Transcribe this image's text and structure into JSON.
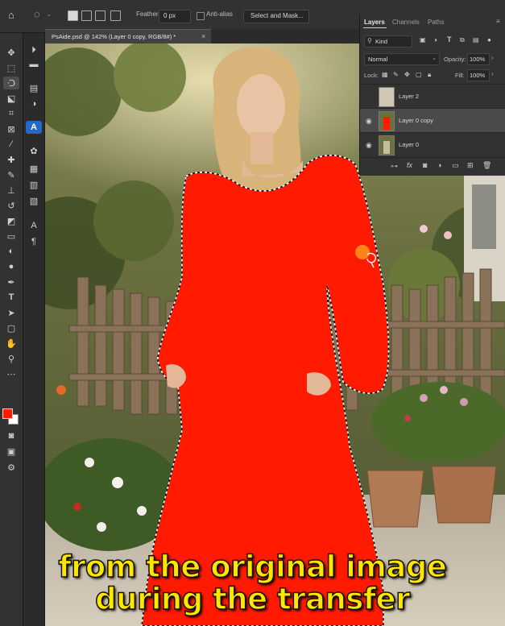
{
  "options_bar": {
    "feather_label": "Feather:",
    "feather_value": "0 px",
    "antialias_label": "Anti-alias",
    "select_mask_label": "Select and Mask..."
  },
  "document_tab": {
    "title": "PsAide.psd @ 142% (Layer 0 copy, RGB/8#) *",
    "close_glyph": "×"
  },
  "layers_panel": {
    "tabs": [
      "Layers",
      "Channels",
      "Paths"
    ],
    "filter_kind": "Kind",
    "blend_mode": "Normal",
    "opacity_label": "Opacity:",
    "opacity_value": "100%",
    "lock_label": "Lock:",
    "fill_label": "Fill:",
    "fill_value": "100%",
    "layers": [
      {
        "name": "Layer 2",
        "visible": false,
        "selected": false
      },
      {
        "name": "Layer 0 copy",
        "visible": true,
        "selected": true
      },
      {
        "name": "Layer 0",
        "visible": true,
        "selected": false
      }
    ]
  },
  "subtitle": {
    "line1": "from the original image",
    "line2": "during the transfer"
  },
  "colors": {
    "foreground": "#ff1a00",
    "background": "#ffffff",
    "subtitle": "#ffe600",
    "selection_fill": "#ff1a00"
  },
  "icons": {
    "home": "home-icon",
    "lasso": "lasso-icon",
    "ai_tool": "ai-tool-icon"
  }
}
